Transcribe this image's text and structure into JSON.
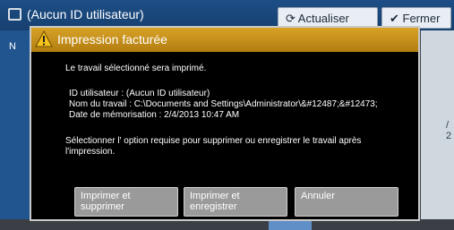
{
  "window": {
    "title": "(Aucun ID utilisateur)",
    "refresh_label": "Actualiser",
    "close_label": "Fermer",
    "side_letter": "N",
    "right_edge_text": "/ 2"
  },
  "dialog": {
    "title": "Impression facturée",
    "message": "Le travail sélectionné sera imprimé.",
    "user_id": "ID utilisateur : (Aucun ID utilisateur)",
    "job_name": "Nom du travail : C:\\Documents and Settings\\Administrator\\&#12487;&#12473;",
    "stored_date": "Date de mémorisation : 2/4/2013 10:47 AM",
    "instruction_line1": "Sélectionner l' option requise pour supprimer ou enregistrer le travail après",
    "instruction_line2": "l'impression.",
    "buttons": {
      "print_delete_line1": "Imprimer et",
      "print_delete_line2": "supprimer",
      "print_save_line1": "Imprimer et",
      "print_save_line2": "enregistrer",
      "cancel": "Annuler"
    }
  },
  "colors": {
    "header_accent": "#d29a1f",
    "button_bg": "#9a9a9a",
    "window_header": "#1d4e86"
  }
}
